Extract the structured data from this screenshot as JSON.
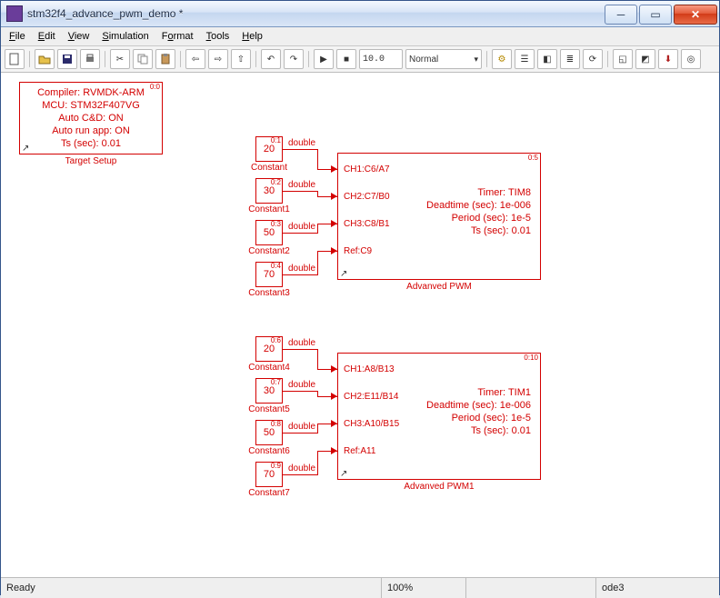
{
  "window": {
    "title": "stm32f4_advance_pwm_demo *"
  },
  "menu": {
    "file": "File",
    "edit": "Edit",
    "view": "View",
    "sim": "Simulation",
    "format": "Format",
    "tools": "Tools",
    "help": "Help"
  },
  "toolbar": {
    "stop_time": "10.0",
    "sim_mode": "Normal"
  },
  "target_setup": {
    "corner": "0:0",
    "l1": "Compiler: RVMDK-ARM",
    "l2": "MCU: STM32F407VG",
    "l3": "Auto C&D: ON",
    "l4": "Auto run app: ON",
    "l5": "Ts (sec): 0.01",
    "label": "Target Setup"
  },
  "constants": [
    {
      "corner": "0:1",
      "value": "20",
      "label": "Constant",
      "type": "double"
    },
    {
      "corner": "0:2",
      "value": "30",
      "label": "Constant1",
      "type": "double"
    },
    {
      "corner": "0:3",
      "value": "50",
      "label": "Constant2",
      "type": "double"
    },
    {
      "corner": "0:4",
      "value": "70",
      "label": "Constant3",
      "type": "double"
    },
    {
      "corner": "0:6",
      "value": "20",
      "label": "Constant4",
      "type": "double"
    },
    {
      "corner": "0:7",
      "value": "30",
      "label": "Constant5",
      "type": "double"
    },
    {
      "corner": "0:8",
      "value": "50",
      "label": "Constant6",
      "type": "double"
    },
    {
      "corner": "0:9",
      "value": "70",
      "label": "Constant7",
      "type": "double"
    }
  ],
  "pwm_blocks": [
    {
      "corner": "0:5",
      "ports": [
        "CH1:C6/A7",
        "CH2:C7/B0",
        "CH3:C8/B1",
        "Ref:C9"
      ],
      "params": [
        "Timer: TIM8",
        "Deadtime (sec): 1e-006",
        "Period (sec): 1e-5",
        "Ts (sec): 0.01"
      ],
      "label": "Advanved PWM"
    },
    {
      "corner": "0:10",
      "ports": [
        "CH1:A8/B13",
        "CH2:E11/B14",
        "CH3:A10/B15",
        "Ref:A11"
      ],
      "params": [
        "Timer: TIM1",
        "Deadtime (sec): 1e-006",
        "Period (sec): 1e-5",
        "Ts (sec): 0.01"
      ],
      "label": "Advanved PWM1"
    }
  ],
  "status": {
    "ready": "Ready",
    "zoom": "100%",
    "solver": "ode3"
  }
}
